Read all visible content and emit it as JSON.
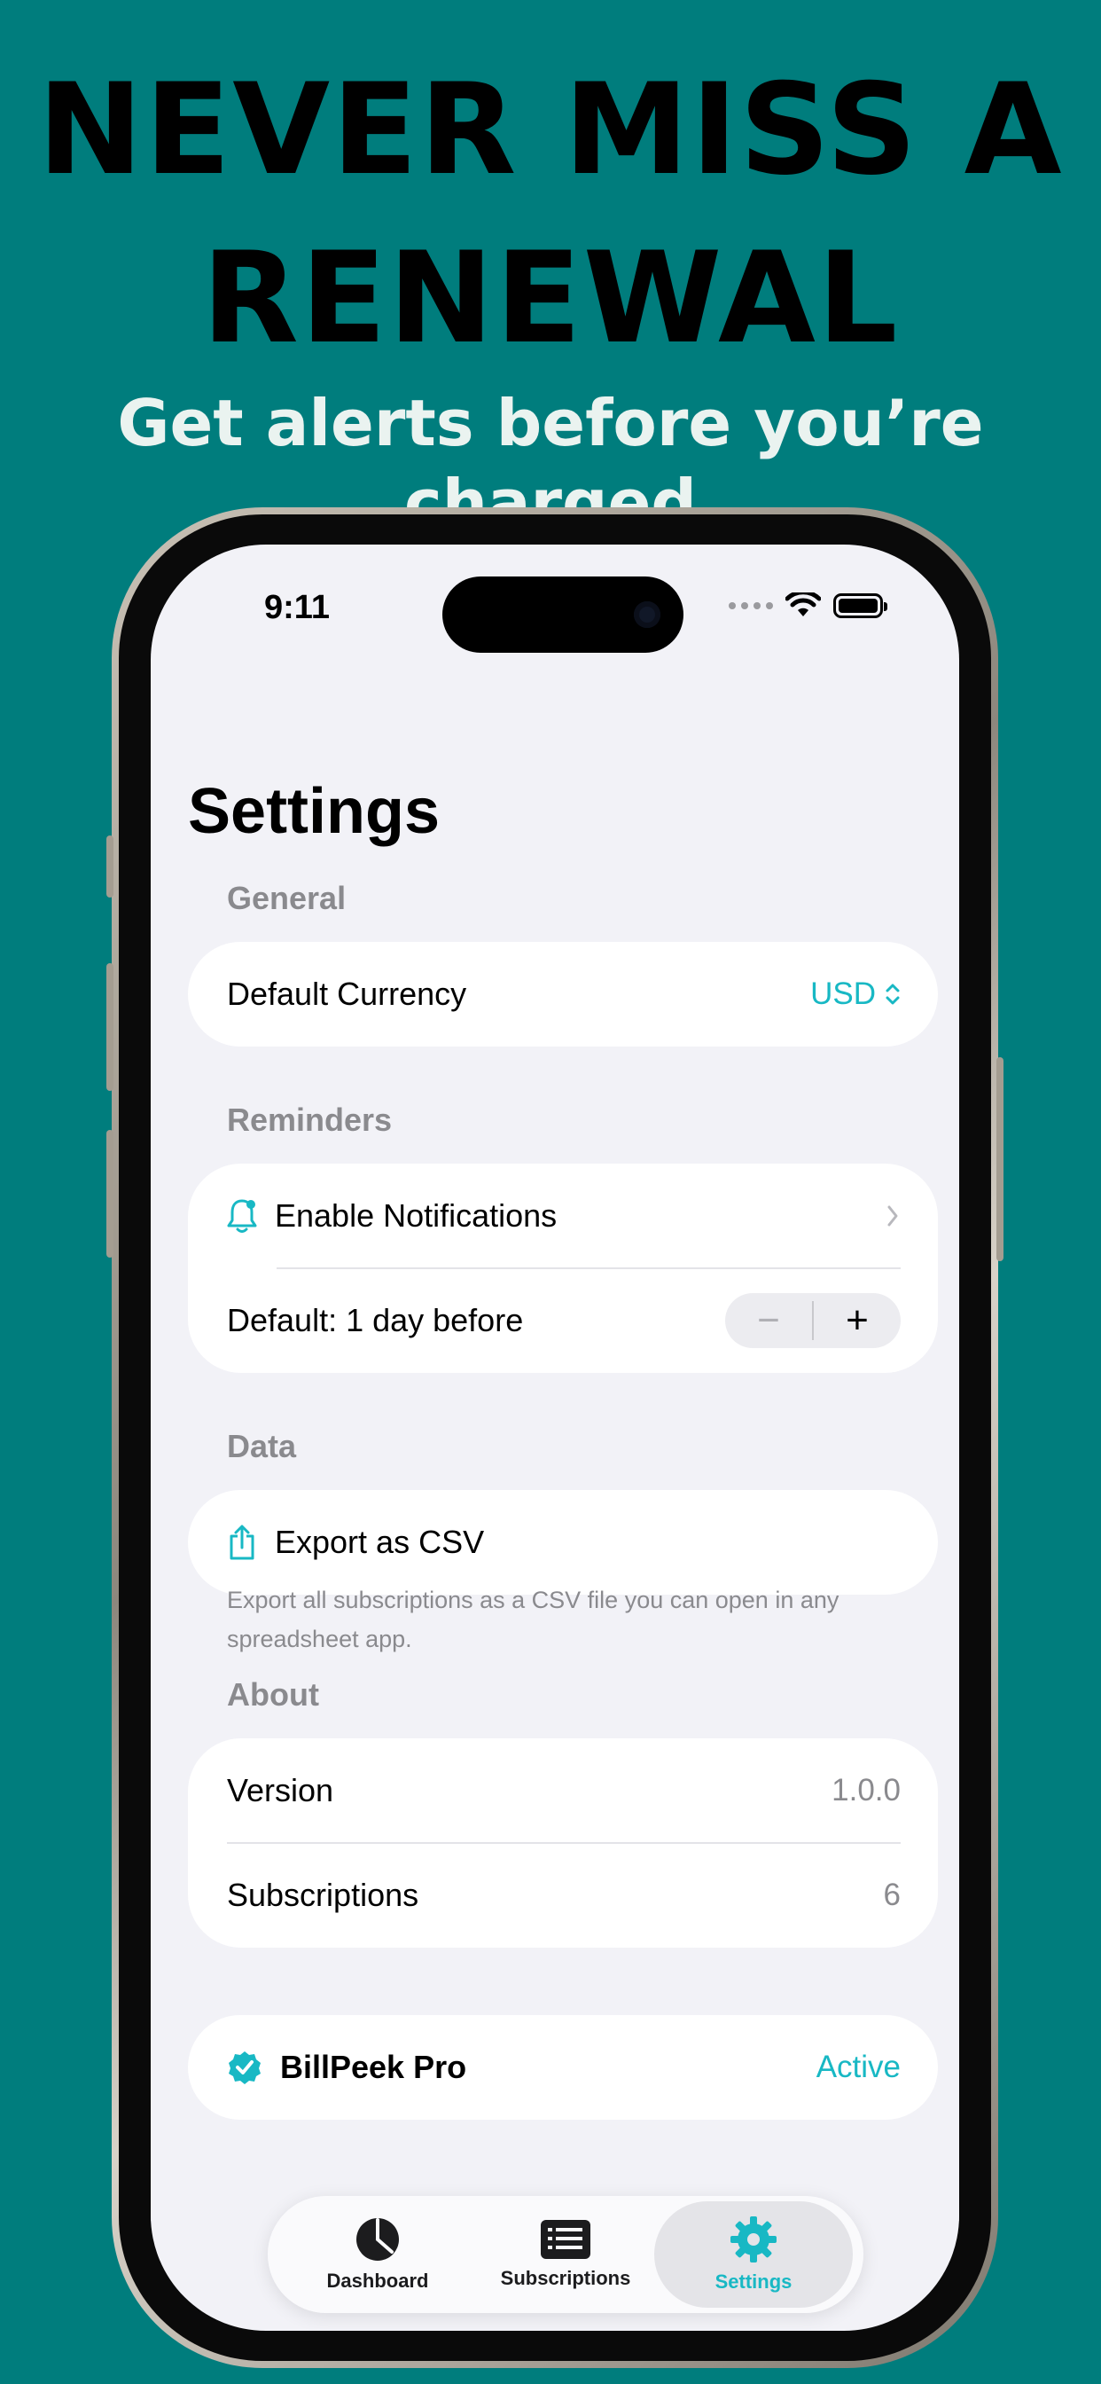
{
  "promo": {
    "headline_line1": "NEVER MISS A",
    "headline_line2": "RENEWAL",
    "subheadline": "Get alerts before you’re charged"
  },
  "status_bar": {
    "time": "9:11"
  },
  "settings": {
    "title": "Settings",
    "general": {
      "header": "General",
      "default_currency_label": "Default Currency",
      "default_currency_value": "USD"
    },
    "reminders": {
      "header": "Reminders",
      "enable_notifications_label": "Enable Notifications",
      "default_label": "Default: 1 day before",
      "stepper_minus": "−",
      "stepper_plus": "+"
    },
    "data": {
      "header": "Data",
      "export_label": "Export as CSV",
      "footnote": "Export all subscriptions as a CSV file you can open in any spreadsheet app."
    },
    "about": {
      "header": "About",
      "version_label": "Version",
      "version_value": "1.0.0",
      "subscriptions_label": "Subscriptions",
      "subscriptions_value": "6"
    },
    "pro": {
      "label": "BillPeek Pro",
      "status": "Active"
    }
  },
  "tabbar": {
    "tabs": [
      {
        "label": "Dashboard",
        "icon": "pie-chart-icon"
      },
      {
        "label": "Subscriptions",
        "icon": "list-icon"
      },
      {
        "label": "Settings",
        "icon": "gear-icon",
        "selected": true
      }
    ]
  },
  "colors": {
    "background": "#007d7d",
    "accent": "#18b8c4",
    "screen_bg": "#f2f2f7"
  }
}
